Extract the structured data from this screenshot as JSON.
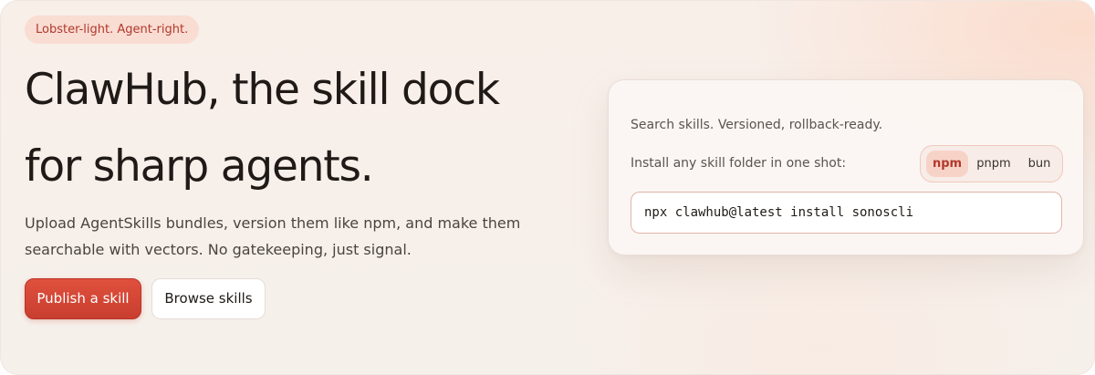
{
  "hero": {
    "tagline": "Lobster-light. Agent-right.",
    "headline_line1": "ClawHub, the skill dock",
    "headline_line2": "for sharp agents.",
    "description": "Upload AgentSkills bundles, version them like npm, and make them searchable with vectors. No gatekeeping, just signal.",
    "primary_button": "Publish a skill",
    "secondary_button": "Browse skills"
  },
  "install_card": {
    "search_text": "Search skills. Versioned, rollback-ready.",
    "install_text": "Install any skill folder in one shot:",
    "package_managers": [
      "npm",
      "pnpm",
      "bun"
    ],
    "selected_manager": "npm",
    "command": "npx clawhub@latest install sonoscli"
  },
  "colors": {
    "accent": "#d9493a",
    "tag_background": "#f9dcd2",
    "tag_text": "#b2392c"
  }
}
